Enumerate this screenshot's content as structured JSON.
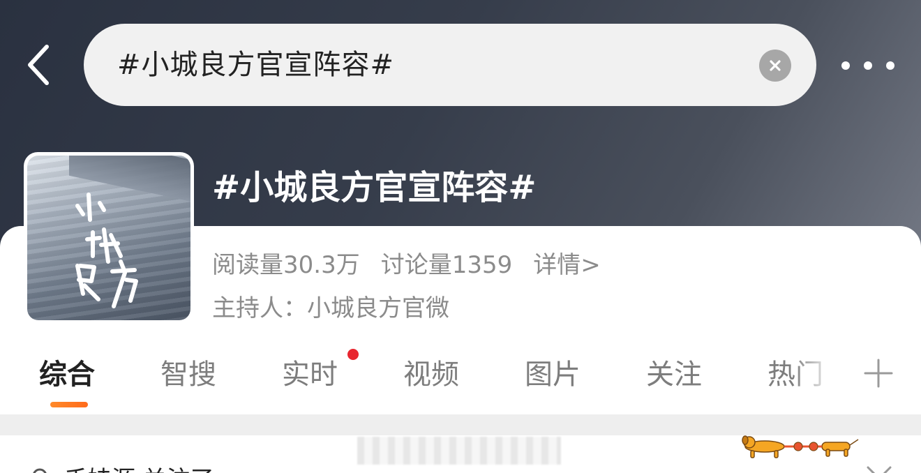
{
  "header": {
    "back_icon": "chevron-left-icon",
    "search_query": "#小城良方官宣阵容#",
    "clear_icon": "close-circle-icon",
    "more_icon": "more-horizontal-icon",
    "gradient_colors": [
      "#2a3140",
      "#737884"
    ]
  },
  "topic": {
    "title": "#小城良方官宣阵容#",
    "read_count": "阅读量30.3万",
    "discussion_count": "讨论量1359",
    "details_link": "详情>",
    "host": "主持人：小城良方官微",
    "cover_text": "小城良方"
  },
  "tabs": {
    "items": [
      "综合",
      "智搜",
      "实时",
      "视频",
      "图片",
      "关注",
      "热门"
    ],
    "active_index": 0,
    "active_color": "#ff7a22",
    "badge_color": "#e8262f",
    "add_icon": "plus-icon"
  },
  "next_post": {
    "partial_text": "千娃源 关注了"
  }
}
